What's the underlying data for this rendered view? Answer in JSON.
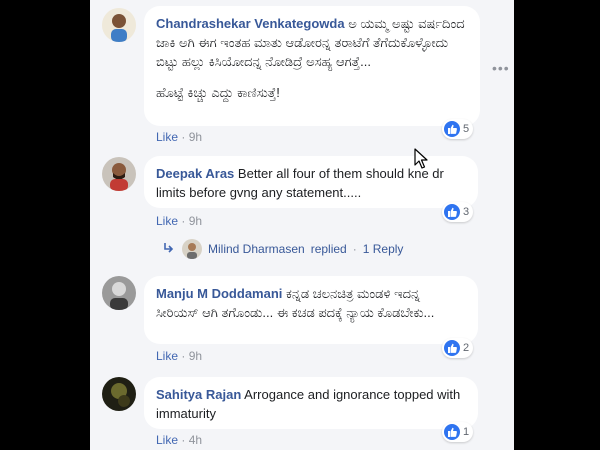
{
  "comments": [
    {
      "author": "Chandrashekar Venkategowda",
      "text": "ಅ ಯಮ್ಮ ಅಷ್ಟು ವರ್ಷದಿಂದ ಜಾಕಿ ಅಗಿ ಈಗ ಇಂತಹ ಮಾತು ಆಡೋರನ್ನ ತರಾಟೆಗೆ ತೆಗೆದುಕೊಳ್ಳೋದು ಬಿಟ್ಟು ಹಲ್ಲು ಕಿಸಿಯೋದನ್ನ ನೋಡಿದ್ರೆ ಅಸಹ್ಯ ಆಗತ್ತೆ...",
      "text2": "ಹೊಟ್ಟೆ ಕಿಚ್ಚು ಎದ್ದು ಕಾಣಿಸುತ್ತೆ!",
      "like_label": "Like",
      "time": "9h",
      "reactions": "5"
    },
    {
      "author": "Deepak Aras",
      "text": "Better all four of them should kne dr limits before gvng any statement.....",
      "like_label": "Like",
      "time": "9h",
      "reactions": "3",
      "replies": {
        "replier": "Milind Dharmasen",
        "replied_label": "replied",
        "count_label": "1 Reply"
      }
    },
    {
      "author": "Manju M Doddamani",
      "text": "ಕನ್ನಡ ಚಲನಚಿತ್ರ ಮಂಡಳಿ ಇದನ್ನ ಸೀರಿಯಸ್ ಆಗಿ ತಗೊಂಡು... ಈ ಕಚಡ ಪದಕ್ಕೆ ನ್ಯಾಯ ಕೊಡಬೇಕು...",
      "like_label": "Like",
      "time": "9h",
      "reactions": "2"
    },
    {
      "author": "Sahitya Rajan",
      "text": "Arrogance and ignorance topped with immaturity",
      "like_label": "Like",
      "time": "4h",
      "reactions": "1"
    }
  ],
  "options_glyph": "•••",
  "separator": "·",
  "colors": {
    "backdrop": "#000000",
    "panel": "#f4f5f8",
    "bubble": "#ffffff",
    "author": "#385898",
    "link": "#4267b2",
    "meta": "#90949c",
    "reaction": "#2f74f0"
  },
  "icons": [
    "thumbs-up-icon",
    "reply-arrow-icon",
    "more-options-icon",
    "cursor-icon"
  ]
}
